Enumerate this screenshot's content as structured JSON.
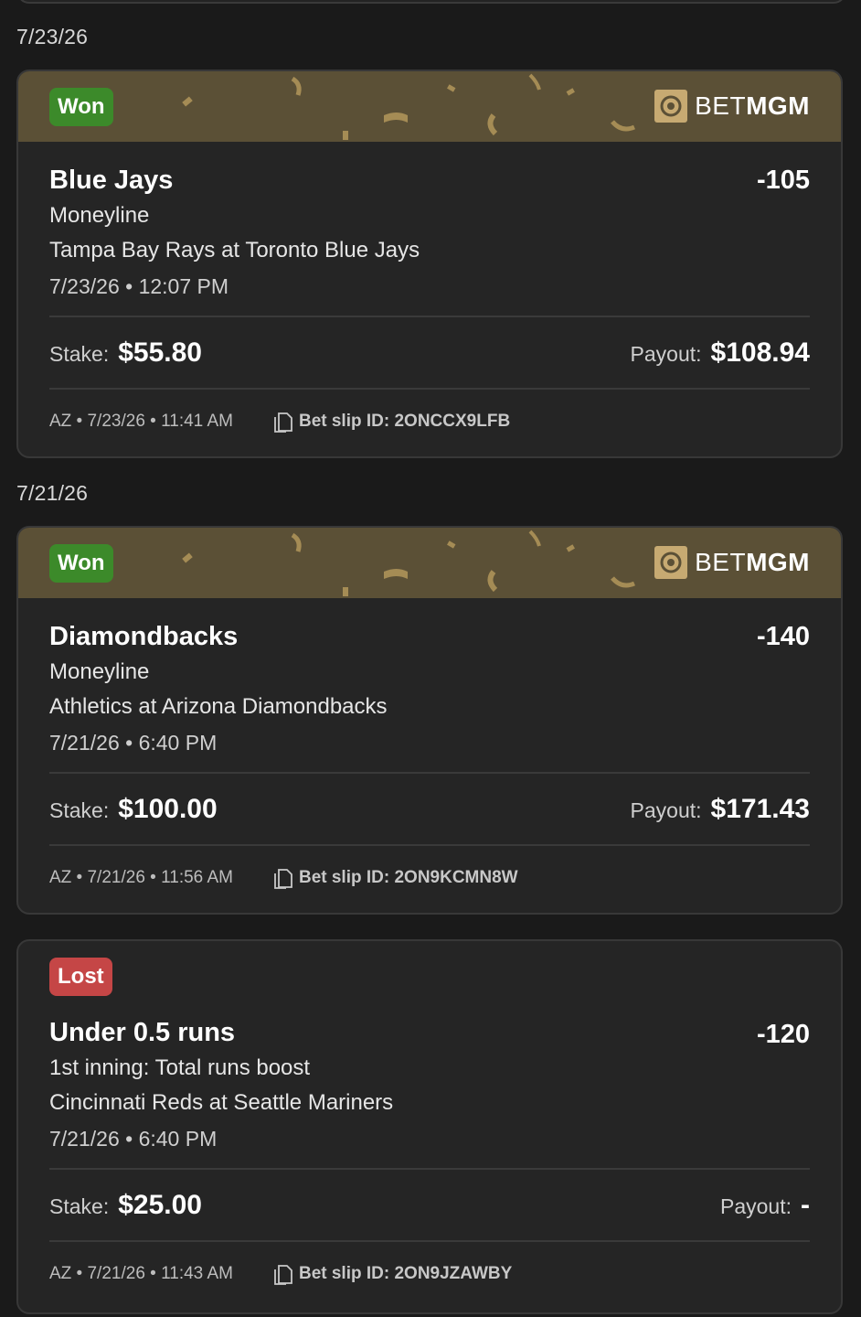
{
  "groups": [
    {
      "date": "7/23/26",
      "cards": [
        {
          "status": "Won",
          "brand": {
            "light": "BET",
            "bold": "MGM"
          },
          "pick": "Blue Jays",
          "odds": "-105",
          "market": "Moneyline",
          "matchup": "Tampa Bay Rays at Toronto Blue Jays",
          "game_time": "7/23/26 • 12:07 PM",
          "stake_label": "Stake:",
          "stake": "$55.80",
          "payout_label": "Payout:",
          "payout": "$108.94",
          "placed": "AZ • 7/23/26 • 11:41 AM",
          "slip_id": "Bet slip ID: 2ONCCX9LFB"
        }
      ]
    },
    {
      "date": "7/21/26",
      "cards": [
        {
          "status": "Won",
          "brand": {
            "light": "BET",
            "bold": "MGM"
          },
          "pick": "Diamondbacks",
          "odds": "-140",
          "market": "Moneyline",
          "matchup": "Athletics at Arizona Diamondbacks",
          "game_time": "7/21/26 • 6:40 PM",
          "stake_label": "Stake:",
          "stake": "$100.00",
          "payout_label": "Payout:",
          "payout": "$171.43",
          "placed": "AZ • 7/21/26 • 11:56 AM",
          "slip_id": "Bet slip ID: 2ON9KCMN8W"
        },
        {
          "status": "Lost",
          "pick": "Under 0.5 runs",
          "odds": "-120",
          "market": "1st inning: Total runs boost",
          "matchup": "Cincinnati Reds at Seattle Mariners",
          "game_time": "7/21/26 • 6:40 PM",
          "stake_label": "Stake:",
          "stake": "$25.00",
          "payout_label": "Payout:",
          "payout": "-",
          "placed": "AZ • 7/21/26 • 11:43 AM",
          "slip_id": "Bet slip ID: 2ON9JZAWBY"
        }
      ]
    }
  ],
  "colors": {
    "won": "#3c8a2a",
    "lost": "#c54646",
    "banner": "#5b5036",
    "gold": "#c7aa72"
  },
  "icons": {
    "slip": "document-copy-icon",
    "brand": "lion-logo-icon"
  }
}
